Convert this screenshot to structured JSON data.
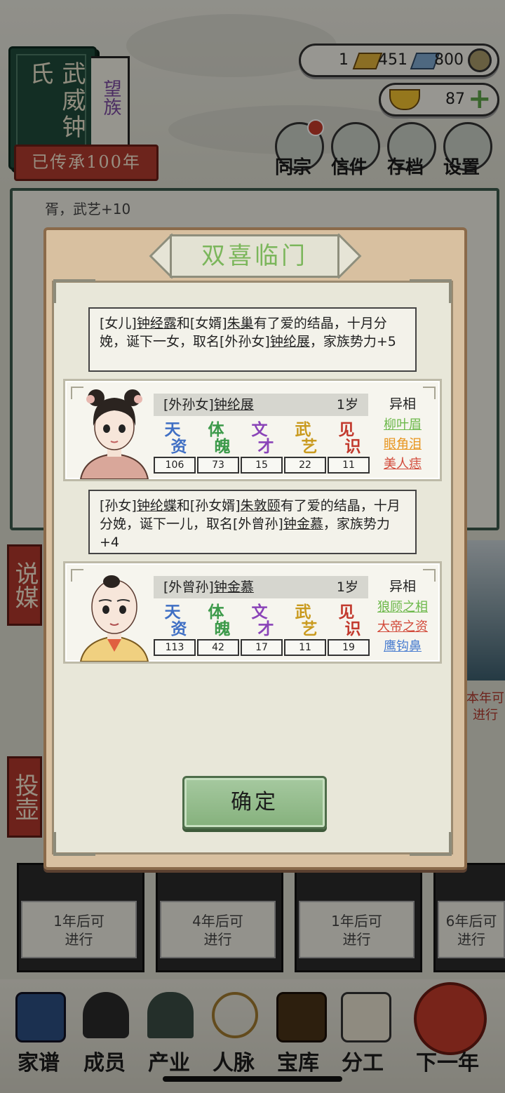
{
  "clan": {
    "name": "武威钟氏",
    "rank": "望族",
    "inherited": "已传承100年"
  },
  "resources": {
    "currency_a": "1",
    "currency_b": "451",
    "currency_c": "800",
    "ingots": "87"
  },
  "top_menu": [
    {
      "label": "同宗",
      "icon": "clan-book-icon"
    },
    {
      "label": "信件",
      "icon": "letter-icon"
    },
    {
      "label": "存档",
      "icon": "brush-icon"
    },
    {
      "label": "设置",
      "icon": "gear-icon"
    }
  ],
  "background": {
    "log_partial": "胥，武艺+10",
    "side_tags": [
      "说媒",
      "投壶"
    ],
    "year_event_partial": "本年可进行",
    "timers": [
      "1年后可\n进行",
      "4年后可\n进行",
      "1年后可\n进行",
      "6年后可\n进行"
    ]
  },
  "modal": {
    "title": "双喜临门",
    "events": [
      {
        "message": {
          "p1": "[女儿]",
          "n1": "钟经露",
          "p2": "和[女婿]",
          "n2": "朱巢",
          "p3": "有了爱的结晶，十月分娩，诞下一女，取名[外孙女]",
          "n3": "钟纶展",
          "p4": "，家族势力+5"
        },
        "child": {
          "relation": "[外孙女]",
          "name": "钟纶展",
          "age": "1岁",
          "stats": {
            "tianzi": "106",
            "tipo": "73",
            "wencai": "15",
            "wuyi": "22",
            "jianshi": "11"
          },
          "traits_header": "异相",
          "traits": [
            "柳叶眉",
            "眼角泪",
            "美人痣"
          ]
        }
      },
      {
        "message": {
          "p1": "[孙女]",
          "n1": "钟纶蝶",
          "p2": "和[孙女婿]",
          "n2": "朱敦颐",
          "p3": "有了爱的结晶，十月分娩，诞下一儿，取名[外曾孙]",
          "n3": "钟金慕",
          "p4": "，家族势力+4"
        },
        "child": {
          "relation": "[外曾孙]",
          "name": "钟金慕",
          "age": "1岁",
          "stats": {
            "tianzi": "113",
            "tipo": "42",
            "wencai": "17",
            "wuyi": "11",
            "jianshi": "19"
          },
          "traits_header": "异相",
          "traits": [
            "狼顾之相",
            "大帝之资",
            "鹰钩鼻"
          ]
        }
      }
    ],
    "stat_labels": {
      "tianzi": [
        "天",
        "资"
      ],
      "tipo": [
        "体",
        "魄"
      ],
      "wencai": [
        "文",
        "才"
      ],
      "wuyi": [
        "武",
        "艺"
      ],
      "jianshi": [
        "见",
        "识"
      ]
    },
    "confirm_label": "确定"
  },
  "bottom_nav": [
    {
      "label": "家谱",
      "icon": "genealogy-book-icon"
    },
    {
      "label": "成员",
      "icon": "member-portrait-icon"
    },
    {
      "label": "产业",
      "icon": "building-icon"
    },
    {
      "label": "人脉",
      "icon": "network-icon"
    },
    {
      "label": "宝库",
      "icon": "treasure-chest-icon"
    },
    {
      "label": "分工",
      "icon": "scroll-icon"
    },
    {
      "label": "下一年",
      "icon": "lantern-icon"
    }
  ],
  "colors": {
    "stat_tianzi": "#3f6fc4",
    "stat_tipo": "#3c9a4a",
    "stat_wencai": "#8a44b8",
    "stat_wuyi": "#c99a1e",
    "stat_jianshi": "#c23a2e",
    "trait_green": "#6cb84a",
    "trait_orange": "#e8951e",
    "trait_red": "#d24a3a",
    "trait_blue": "#4c7fd0",
    "title_green": "#7bb65b"
  }
}
